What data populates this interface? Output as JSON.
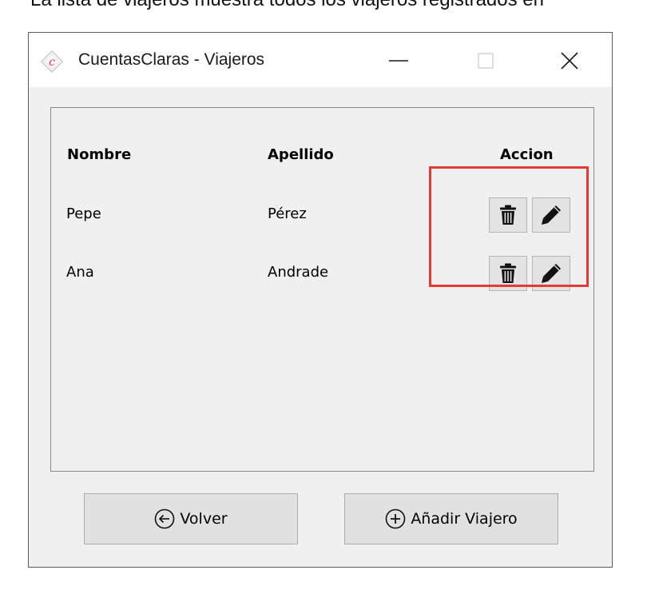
{
  "caption": "La lista de viajeros muestra todos los viajeros registrados en",
  "window": {
    "title": "CuentasClaras - Viajeros",
    "icon": "cuentasclaras-logo-icon"
  },
  "table": {
    "headers": {
      "nombre": "Nombre",
      "apellido": "Apellido",
      "accion": "Accion"
    },
    "rows": [
      {
        "nombre": "Pepe",
        "apellido": "Pérez"
      },
      {
        "nombre": "Ana",
        "apellido": "Andrade"
      }
    ],
    "row_actions": [
      "trash-icon",
      "pencil-icon"
    ]
  },
  "footer": {
    "back_label": "Volver",
    "add_label": "Añadir Viajero"
  },
  "colors": {
    "highlight": "#e53935",
    "window_bg": "#f0f0f0",
    "button_bg": "#e1e1e1"
  }
}
